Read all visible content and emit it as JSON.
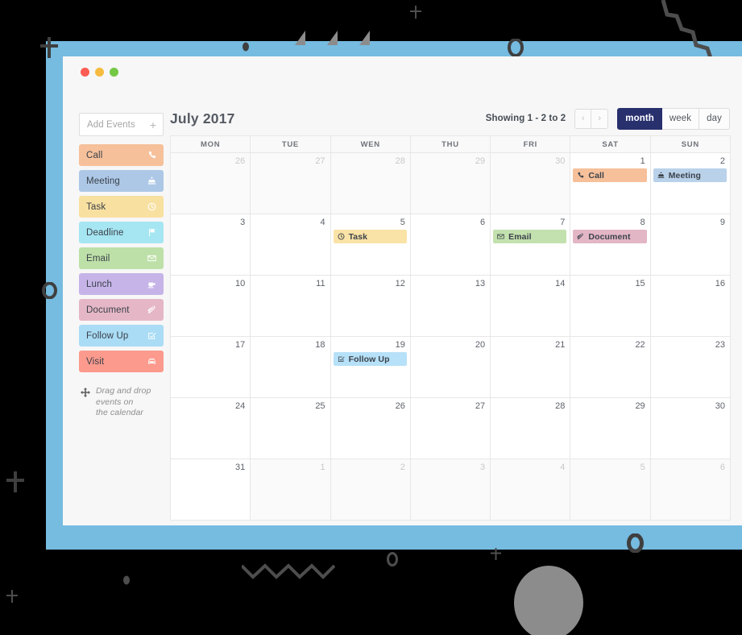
{
  "window": {
    "traffic_lights": [
      "close",
      "minimize",
      "maximize"
    ]
  },
  "sidebar": {
    "add_events": {
      "placeholder": "Add Events",
      "plus_label": "+"
    },
    "event_types": [
      {
        "label": "Call",
        "icon": "phone-icon",
        "color": "#f6c09a"
      },
      {
        "label": "Meeting",
        "icon": "meeting-icon",
        "color": "#adc8e6"
      },
      {
        "label": "Task",
        "icon": "clock-icon",
        "color": "#f8e0a0"
      },
      {
        "label": "Deadline",
        "icon": "flag-icon",
        "color": "#a6e6f2"
      },
      {
        "label": "Email",
        "icon": "envelope-icon",
        "color": "#bde0a8"
      },
      {
        "label": "Lunch",
        "icon": "coffee-icon",
        "color": "#c6b4e8"
      },
      {
        "label": "Document",
        "icon": "paperclip-icon",
        "color": "#e5b7c6"
      },
      {
        "label": "Follow Up",
        "icon": "checkbox-icon",
        "color": "#aadcf5"
      },
      {
        "label": "Visit",
        "icon": "car-icon",
        "color": "#fb9a8d"
      }
    ],
    "hint": {
      "icon": "move-arrows-icon",
      "line1": "Drag and drop",
      "line2": "events on",
      "line3": "the calendar"
    }
  },
  "calendar": {
    "title": "July 2017",
    "showing": "Showing 1 - 2 to 2",
    "nav": {
      "prev": "‹",
      "next": "›"
    },
    "views": [
      {
        "label": "month",
        "active": true
      },
      {
        "label": "week",
        "active": false
      },
      {
        "label": "day",
        "active": false
      }
    ],
    "day_headers": [
      "MON",
      "TUE",
      "WEN",
      "THU",
      "FRI",
      "SAT",
      "SUN"
    ],
    "weeks": [
      [
        {
          "num": "26",
          "other": true
        },
        {
          "num": "27",
          "other": true
        },
        {
          "num": "28",
          "other": true
        },
        {
          "num": "29",
          "other": true
        },
        {
          "num": "30",
          "other": true
        },
        {
          "num": "1",
          "other": false,
          "event": {
            "label": "Call",
            "icon": "phone-icon",
            "color": "#f6c09a"
          }
        },
        {
          "num": "2",
          "other": false,
          "event": {
            "label": "Meeting",
            "icon": "meeting-icon",
            "color": "#b9d2ea"
          }
        }
      ],
      [
        {
          "num": "3",
          "other": false
        },
        {
          "num": "4",
          "other": false
        },
        {
          "num": "5",
          "other": false,
          "event": {
            "label": "Task",
            "icon": "clock-icon",
            "color": "#fae3a6"
          }
        },
        {
          "num": "6",
          "other": false
        },
        {
          "num": "7",
          "other": false,
          "event": {
            "label": "Email",
            "icon": "envelope-icon",
            "color": "#c3e1ae"
          }
        },
        {
          "num": "8",
          "other": false,
          "event": {
            "label": "Document",
            "icon": "paperclip-icon",
            "color": "#e3b6c6"
          }
        },
        {
          "num": "9",
          "other": false
        }
      ],
      [
        {
          "num": "10",
          "other": false
        },
        {
          "num": "11",
          "other": false
        },
        {
          "num": "12",
          "other": false
        },
        {
          "num": "13",
          "other": false
        },
        {
          "num": "14",
          "other": false
        },
        {
          "num": "15",
          "other": false
        },
        {
          "num": "16",
          "other": false
        }
      ],
      [
        {
          "num": "17",
          "other": false
        },
        {
          "num": "18",
          "other": false
        },
        {
          "num": "19",
          "other": false,
          "event": {
            "label": "Follow Up",
            "icon": "checkbox-icon",
            "color": "#b6e1f8"
          }
        },
        {
          "num": "20",
          "other": false
        },
        {
          "num": "21",
          "other": false
        },
        {
          "num": "22",
          "other": false
        },
        {
          "num": "23",
          "other": false
        }
      ],
      [
        {
          "num": "24",
          "other": false
        },
        {
          "num": "25",
          "other": false
        },
        {
          "num": "26",
          "other": false
        },
        {
          "num": "27",
          "other": false
        },
        {
          "num": "28",
          "other": false
        },
        {
          "num": "29",
          "other": false
        },
        {
          "num": "30",
          "other": false
        }
      ],
      [
        {
          "num": "31",
          "other": false
        },
        {
          "num": "1",
          "other": true
        },
        {
          "num": "2",
          "other": true
        },
        {
          "num": "3",
          "other": true
        },
        {
          "num": "4",
          "other": true
        },
        {
          "num": "5",
          "other": true
        },
        {
          "num": "6",
          "other": true
        }
      ]
    ]
  },
  "theme": {
    "background": "#000000",
    "band": "#76bbe0",
    "accent": "#28306e",
    "deco": "#4d4d4d"
  }
}
